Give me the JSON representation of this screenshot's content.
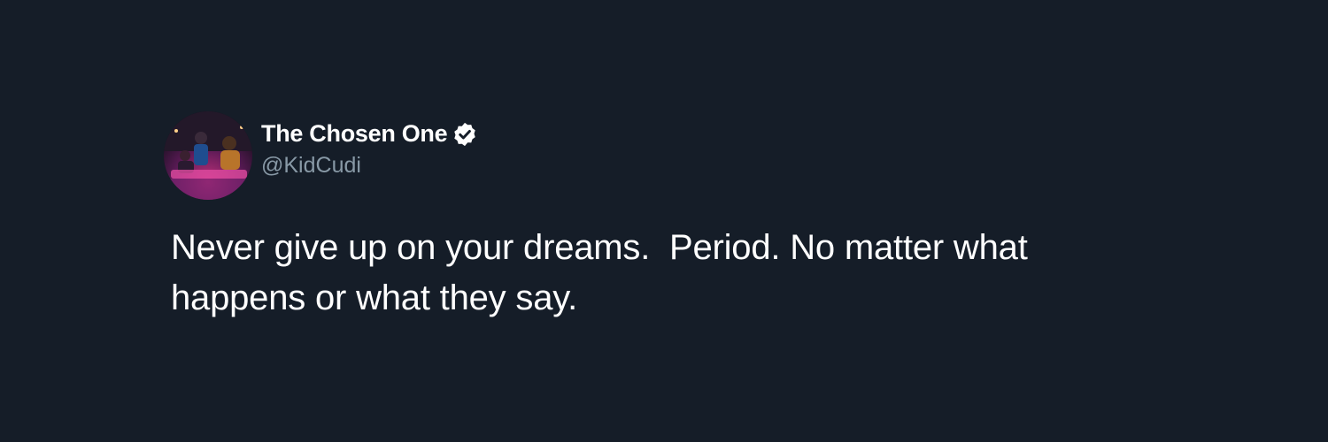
{
  "tweet": {
    "author": {
      "display_name": "The Chosen One",
      "handle": "@KidCudi",
      "verified": true,
      "avatar_icon": "profile-photo"
    },
    "text_lines": [
      "Never give up on your dreams.  Period. No matter what",
      "happens or what they say."
    ]
  },
  "colors": {
    "background": "#151d28",
    "text": "#ffffff",
    "handle": "#8899a6"
  }
}
